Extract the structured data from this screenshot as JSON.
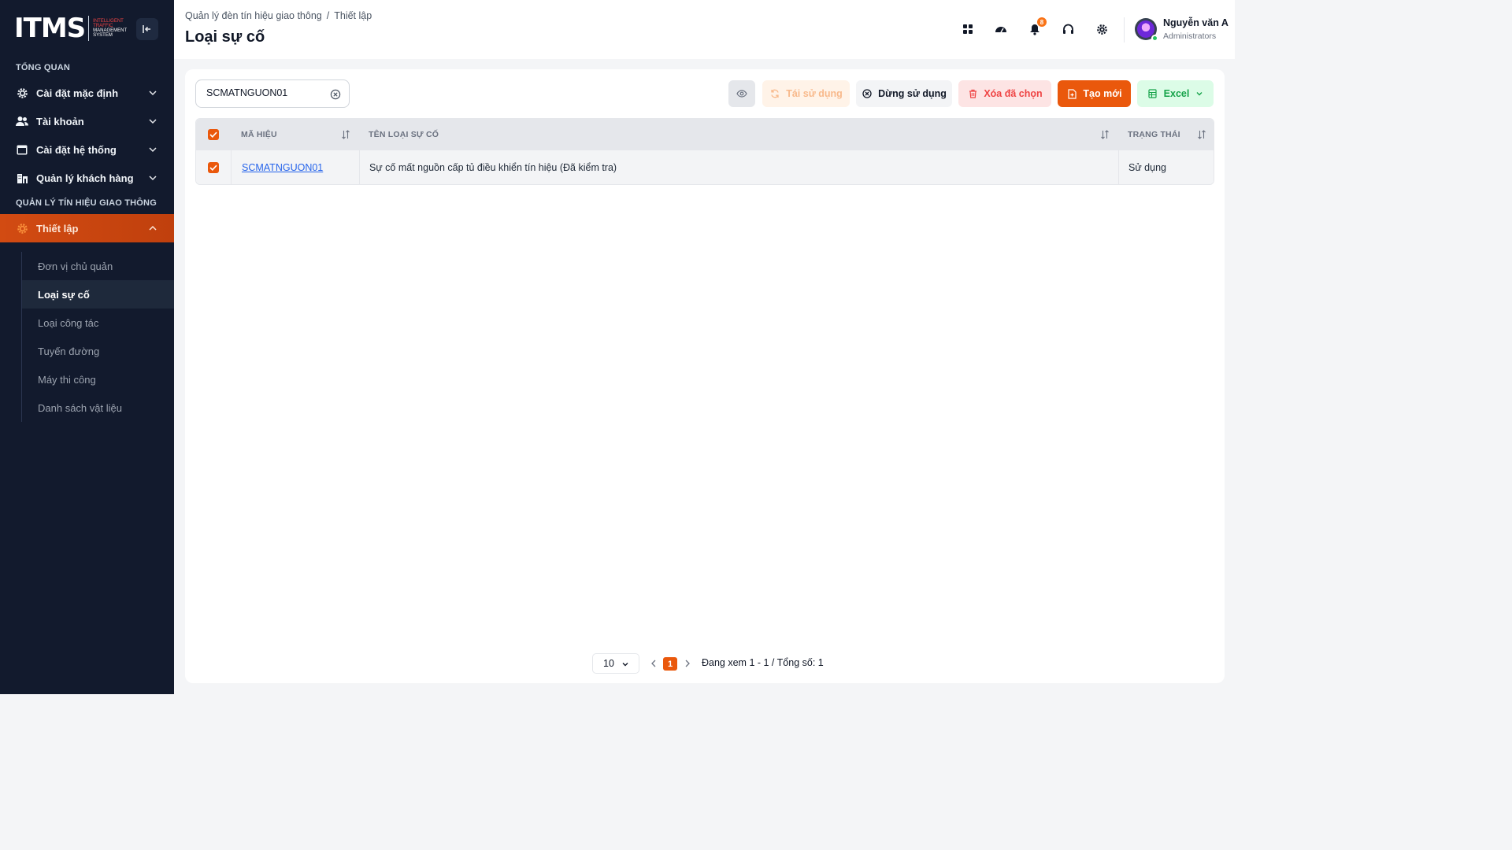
{
  "brand": {
    "logo_text": "ITMS",
    "logo_sub_line1": "INTELLIGENT",
    "logo_sub_line2": "TRAFFIC",
    "logo_sub_line3": "MANAGEMENT",
    "logo_sub_line4": "SYSTEM"
  },
  "sidebar": {
    "section_overview": "TỔNG QUAN",
    "overview_items": [
      {
        "label": "Cài đặt mặc định",
        "icon": "gear-icon"
      },
      {
        "label": "Tài khoản",
        "icon": "users-icon"
      },
      {
        "label": "Cài đặt hệ thống",
        "icon": "window-icon"
      },
      {
        "label": "Quản lý khách hàng",
        "icon": "building-icon"
      }
    ],
    "section_traffic": "QUẢN LÝ TÍN HIỆU GIAO THÔNG",
    "active_group": {
      "label": "Thiết lập",
      "icon": "gear-icon"
    },
    "sub_items": [
      {
        "label": "Đơn vị chủ quản"
      },
      {
        "label": "Loại sự cố"
      },
      {
        "label": "Loại công tác"
      },
      {
        "label": "Tuyến đường"
      },
      {
        "label": "Máy thi công"
      },
      {
        "label": "Danh sách vật liệu"
      }
    ],
    "active_sub_index": 1
  },
  "header": {
    "breadcrumb_root": "Quản lý đèn tín hiệu giao thông",
    "breadcrumb_separator": "/",
    "breadcrumb_current": "Thiết lập",
    "title": "Loại sự cố",
    "notification_count": "8",
    "user_name": "Nguyễn văn A",
    "user_role": "Administrators"
  },
  "toolbar": {
    "search_value": "SCMATNGUON01",
    "reuse_label": "Tái sử dụng",
    "stop_label": "Dừng sử dụng",
    "delete_label": "Xóa đã chọn",
    "create_label": "Tạo mới",
    "excel_label": "Excel"
  },
  "table": {
    "columns": {
      "code": "MÃ HIỆU",
      "name": "TÊN LOẠI SỰ CỐ",
      "status": "TRẠNG THÁI"
    },
    "rows": [
      {
        "code": "SCMATNGUON01",
        "name": "Sự cố mất nguồn cấp tủ điều khiển tín hiệu (Đã kiểm tra)",
        "status": "Sử dụng",
        "checked": true
      }
    ]
  },
  "pagination": {
    "page_size": "10",
    "current_page": "1",
    "info": "Đang xem 1 - 1 / Tổng số: 1"
  },
  "colors": {
    "accent": "#ea580c",
    "sidebar_bg": "#121a2d",
    "link": "#2563eb"
  }
}
